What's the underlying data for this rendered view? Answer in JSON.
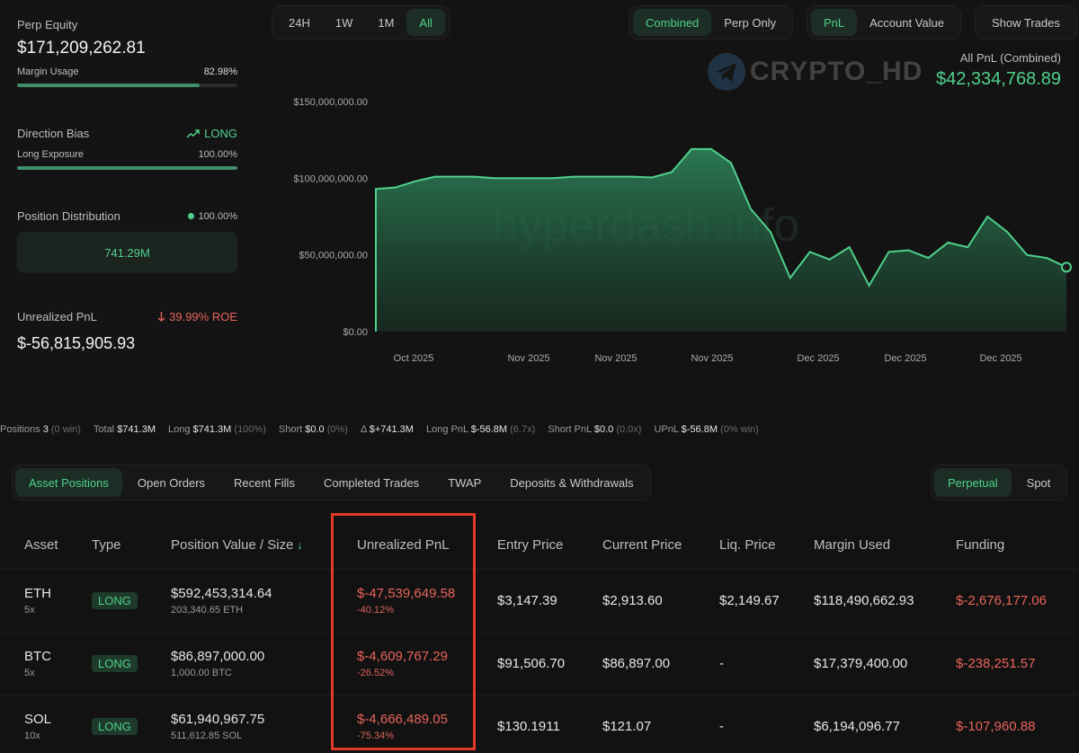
{
  "left": {
    "perp_equity": {
      "label": "Perp Equity",
      "value": "$171,209,262.81"
    },
    "margin_usage": {
      "label": "Margin Usage",
      "value": "82.98%",
      "fraction": 0.8298
    },
    "direction_bias": {
      "label": "Direction Bias",
      "value": "LONG"
    },
    "long_exposure": {
      "label": "Long Exposure",
      "value": "100.00%",
      "fraction": 1.0
    },
    "position_distribution": {
      "label": "Position Distribution",
      "value": "100.00%",
      "box": "741.29M"
    },
    "unrealized_pnl": {
      "label": "Unrealized PnL",
      "roe": "39.99% ROE",
      "value": "$-56,815,905.93"
    }
  },
  "range_tabs": [
    "24H",
    "1W",
    "1M",
    "All"
  ],
  "range_active": 3,
  "mode_tabs": [
    "Combined",
    "Perp Only"
  ],
  "mode_active": 0,
  "metric_tabs": [
    "PnL",
    "Account Value"
  ],
  "metric_active": 0,
  "show_trades": "Show Trades",
  "watermark": "CRYPTO_HD",
  "chart_watermark": "hyperdash.info",
  "all_pnl": {
    "label": "All PnL (Combined)",
    "value": "$42,334,768.89"
  },
  "chart_data": {
    "type": "area",
    "y_ticks": [
      "$150,000,000.00",
      "$100,000,000.00",
      "$50,000,000.00",
      "$0.00"
    ],
    "ylim": [
      0,
      150000000
    ],
    "x_ticks": [
      "Oct 2025",
      "Nov 2025",
      "Nov 2025",
      "Nov 2025",
      "Dec 2025",
      "Dec 2025",
      "Dec 2025"
    ],
    "values": [
      93,
      94,
      98,
      101,
      101,
      101,
      100,
      100,
      100,
      100,
      101,
      101,
      101,
      101,
      100.5,
      104,
      119,
      119,
      110,
      80,
      65,
      35,
      52,
      47,
      55,
      30,
      52,
      53,
      48,
      58,
      55,
      75,
      65,
      50,
      48,
      42
    ],
    "color": "#4fd18b"
  },
  "summary": [
    {
      "k": "Positions",
      "v": "3",
      "x": "(0 win)"
    },
    {
      "k": "Total",
      "v": "$741.3M",
      "x": ""
    },
    {
      "k": "Long",
      "v": "$741.3M",
      "x": "(100%)"
    },
    {
      "k": "Short",
      "v": "$0.0",
      "x": "(0%)"
    },
    {
      "k": "Δ",
      "v": "$+741.3M",
      "x": "",
      "vclass": "green"
    },
    {
      "k": "Long PnL",
      "v": "$-56.8M",
      "x": "(6.7x)",
      "vclass": "red"
    },
    {
      "k": "Short PnL",
      "v": "$0.0",
      "x": "(0.0x)",
      "vclass": "green"
    },
    {
      "k": "UPnL",
      "v": "$-56.8M",
      "x": "(0% win)",
      "vclass": "red"
    }
  ],
  "tabs": [
    "Asset Positions",
    "Open Orders",
    "Recent Fills",
    "Completed Trades",
    "TWAP",
    "Deposits & Withdrawals"
  ],
  "tab_active": 0,
  "market_tabs": [
    "Perpetual",
    "Spot"
  ],
  "market_active": 0,
  "table": {
    "headers": [
      "Asset",
      "Type",
      "Position Value / Size",
      "Unrealized PnL",
      "Entry Price",
      "Current Price",
      "Liq. Price",
      "Margin Used",
      "Funding"
    ],
    "rows": [
      {
        "asset": "ETH",
        "lev": "5x",
        "type": "LONG",
        "value": "$592,453,314.64",
        "size": "203,340.65 ETH",
        "pnl": "$-47,539,649.58",
        "pnl_pct": "-40.12%",
        "entry": "$3,147.39",
        "current": "$2,913.60",
        "liq": "$2,149.67",
        "margin": "$118,490,662.93",
        "funding": "$-2,676,177.06"
      },
      {
        "asset": "BTC",
        "lev": "5x",
        "type": "LONG",
        "value": "$86,897,000.00",
        "size": "1,000.00 BTC",
        "pnl": "$-4,609,767.29",
        "pnl_pct": "-26.52%",
        "entry": "$91,506.70",
        "current": "$86,897.00",
        "liq": "-",
        "margin": "$17,379,400.00",
        "funding": "$-238,251.57"
      },
      {
        "asset": "SOL",
        "lev": "10x",
        "type": "LONG",
        "value": "$61,940,967.75",
        "size": "511,612.85 SOL",
        "pnl": "$-4,666,489.05",
        "pnl_pct": "-75.34%",
        "entry": "$130.1911",
        "current": "$121.07",
        "liq": "-",
        "margin": "$6,194,096.77",
        "funding": "$-107,960.88"
      }
    ]
  }
}
